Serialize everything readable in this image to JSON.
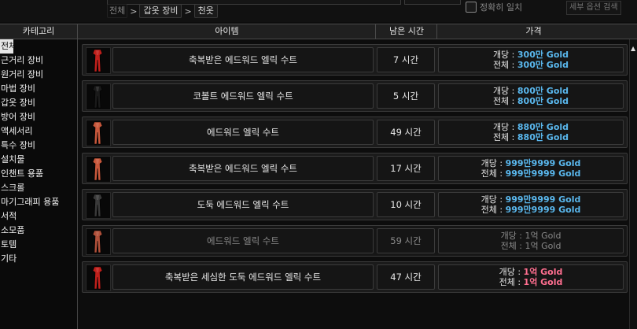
{
  "search": {
    "breadcrumb": [
      "전체",
      "갑옷 장비",
      "천옷"
    ],
    "exact_match_label": "정확히 일치",
    "detail_search_label": "세부 옵션 검색"
  },
  "header": {
    "category": "카테고리",
    "item": "아이템",
    "time_left": "남은 시간",
    "price": "가격"
  },
  "sidebar": {
    "selected_label": "전체",
    "items": [
      "근거리 장비",
      "원거리 장비",
      "마법 장비",
      "갑옷 장비",
      "방어 장비",
      "액세서리",
      "특수 장비",
      "설치물",
      "인챈트 용품",
      "스크롤",
      "마기그래피 용품",
      "서적",
      "소모품",
      "토템",
      "기타"
    ]
  },
  "price_labels": {
    "each": "개당 : ",
    "total": "전체 : "
  },
  "listings": [
    {
      "name": "축복받은 에드워드 엘릭 수트",
      "time": "7 시간",
      "each": "300만 Gold",
      "total": "300만 Gold",
      "color": "#c0201c",
      "disabled": false,
      "price_color": "#5ab8ee"
    },
    {
      "name": "코볼트 에드워드 엘릭 수트",
      "time": "5 시간",
      "each": "800만 Gold",
      "total": "800만 Gold",
      "color": "#1a1a1a",
      "disabled": false,
      "price_color": "#5ab8ee"
    },
    {
      "name": "에드워드 엘릭 수트",
      "time": "49 시간",
      "each": "880만 Gold",
      "total": "880만 Gold",
      "color": "#c8583c",
      "disabled": false,
      "price_color": "#5ab8ee"
    },
    {
      "name": "축복받은 에드워드 엘릭 수트",
      "time": "17 시간",
      "each": "999만9999 Gold",
      "total": "999만9999 Gold",
      "color": "#c8583c",
      "disabled": false,
      "price_color": "#5ab8ee"
    },
    {
      "name": "도둑 에드워드 엘릭 수트",
      "time": "10 시간",
      "each": "999만9999 Gold",
      "total": "999만9999 Gold",
      "color": "#3a3a3a",
      "disabled": false,
      "price_color": "#5ab8ee"
    },
    {
      "name": "에드워드 엘릭 수트",
      "time": "59 시간",
      "each": "1억 Gold",
      "total": "1억 Gold",
      "color": "#b0503a",
      "disabled": true,
      "price_color": "#8a8a8a"
    },
    {
      "name": "축복받은 세심한 도둑 에드워드 엘릭 수트",
      "time": "47 시간",
      "each": "1억 Gold",
      "total": "1억 Gold",
      "color": "#c0201c",
      "disabled": false,
      "price_color": "#ff6f90"
    }
  ]
}
